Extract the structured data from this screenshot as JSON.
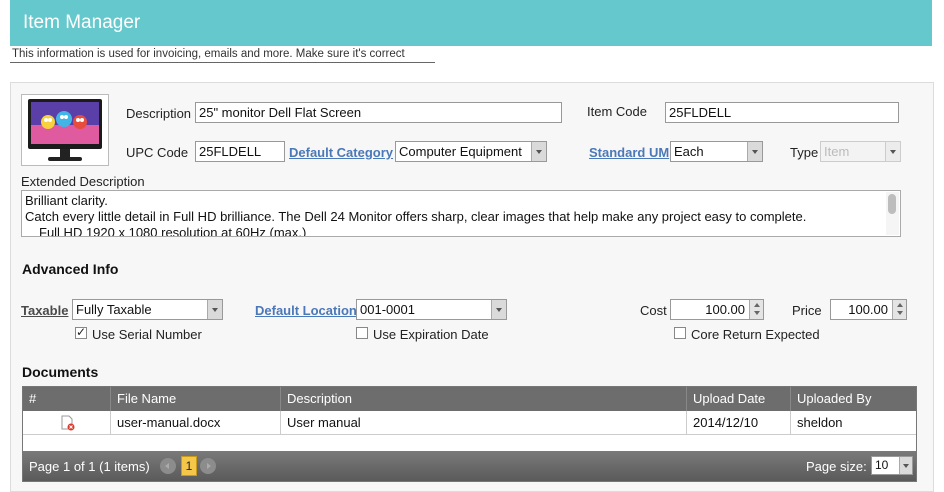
{
  "header": {
    "title": "Item Manager",
    "subtitle": "This information is used for invoicing, emails and more. Make sure it's correct"
  },
  "item": {
    "description_label": "Description",
    "description": "25\" monitor Dell Flat Screen",
    "item_code_label": "Item Code",
    "item_code": "25FLDELL",
    "upc_label": "UPC Code",
    "upc": "25FLDELL",
    "category_label": "Default Category",
    "category": "Computer Equipment",
    "uom_label": "Standard UM",
    "uom": "Each",
    "type_label": "Type",
    "type": "Item",
    "extended_label": "Extended Description",
    "extended_lines": [
      "Brilliant clarity.",
      "Catch every little detail in Full HD brilliance. The Dell 24 Monitor offers sharp, clear images that help make any project easy to complete.",
      "Full HD 1920 x 1080 resolution at 60Hz (max.)"
    ]
  },
  "advanced": {
    "title": "Advanced Info",
    "taxable_label": "Taxable",
    "taxable": "Fully Taxable",
    "location_label": "Default Location",
    "location": "001-0001",
    "cost_label": "Cost",
    "cost": "100.00",
    "price_label": "Price",
    "price": "100.00",
    "serial_label": "Use Serial Number",
    "serial_checked": true,
    "expiration_label": "Use Expiration Date",
    "expiration_checked": false,
    "core_label": "Core Return Expected",
    "core_checked": false
  },
  "documents": {
    "title": "Documents",
    "columns": [
      "#",
      "File Name",
      "Description",
      "Upload Date",
      "Uploaded By"
    ],
    "rows": [
      {
        "file_name": "user-manual.docx",
        "description": "User manual",
        "upload_date": "2014/12/10",
        "uploaded_by": "sheldon",
        "icon": "delete-document-icon"
      }
    ],
    "pager": {
      "info": "Page 1 of 1 (1 items)",
      "current": "1",
      "size_label": "Page size:",
      "size": "10"
    }
  },
  "colors": {
    "header": "#64c8cc",
    "link": "#4a78b8",
    "grid_header": "#6d6d6d",
    "pager_current": "#f4c74a"
  }
}
